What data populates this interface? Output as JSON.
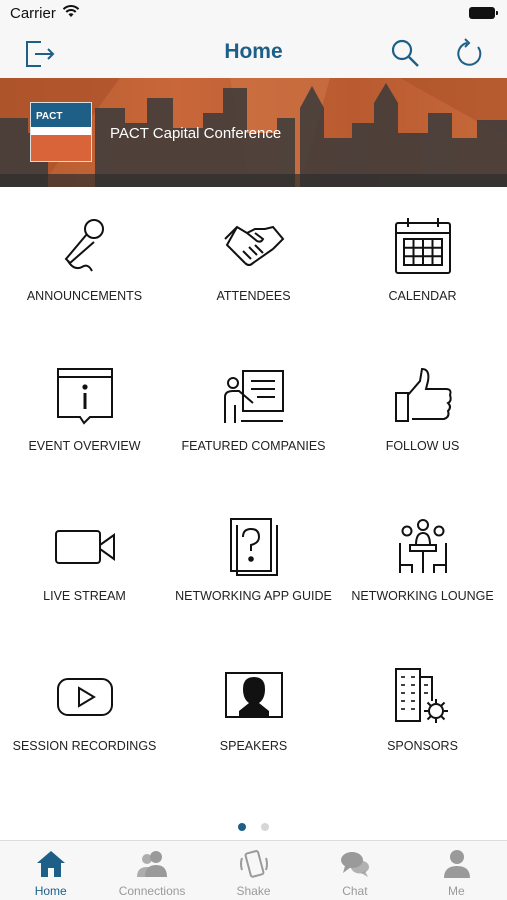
{
  "status_bar": {
    "carrier": "Carrier"
  },
  "nav": {
    "title": "Home"
  },
  "banner": {
    "conference_name": "PACT Capital Conference",
    "logo_text": "PACT"
  },
  "grid": {
    "items": [
      {
        "label": "ANNOUNCEMENTS",
        "icon": "microphone-icon"
      },
      {
        "label": "ATTENDEES",
        "icon": "handshake-icon"
      },
      {
        "label": "CALENDAR",
        "icon": "calendar-icon"
      },
      {
        "label": "EVENT OVERVIEW",
        "icon": "info-board-icon"
      },
      {
        "label": "FEATURED COMPANIES",
        "icon": "presenter-icon"
      },
      {
        "label": "FOLLOW US",
        "icon": "thumbs-up-icon"
      },
      {
        "label": "LIVE STREAM",
        "icon": "video-camera-icon"
      },
      {
        "label": "NETWORKING APP GUIDE",
        "icon": "question-book-icon"
      },
      {
        "label": "NETWORKING LOUNGE",
        "icon": "meeting-table-icon"
      },
      {
        "label": "SESSION RECORDINGS",
        "icon": "play-button-icon"
      },
      {
        "label": "SPEAKERS",
        "icon": "speaker-portrait-icon"
      },
      {
        "label": "SPONSORS",
        "icon": "building-gear-icon"
      }
    ]
  },
  "pagination": {
    "pages": 2,
    "current": 1
  },
  "tab_bar": {
    "items": [
      {
        "label": "Home",
        "icon": "home-icon",
        "active": true
      },
      {
        "label": "Connections",
        "icon": "people-icon",
        "active": false
      },
      {
        "label": "Shake",
        "icon": "phone-shake-icon",
        "active": false
      },
      {
        "label": "Chat",
        "icon": "chat-bubbles-icon",
        "active": false
      },
      {
        "label": "Me",
        "icon": "person-icon",
        "active": false
      }
    ]
  },
  "colors": {
    "accent": "#1d5f86",
    "banner": "#c0623a",
    "tab_inactive": "#9a9a9a"
  }
}
